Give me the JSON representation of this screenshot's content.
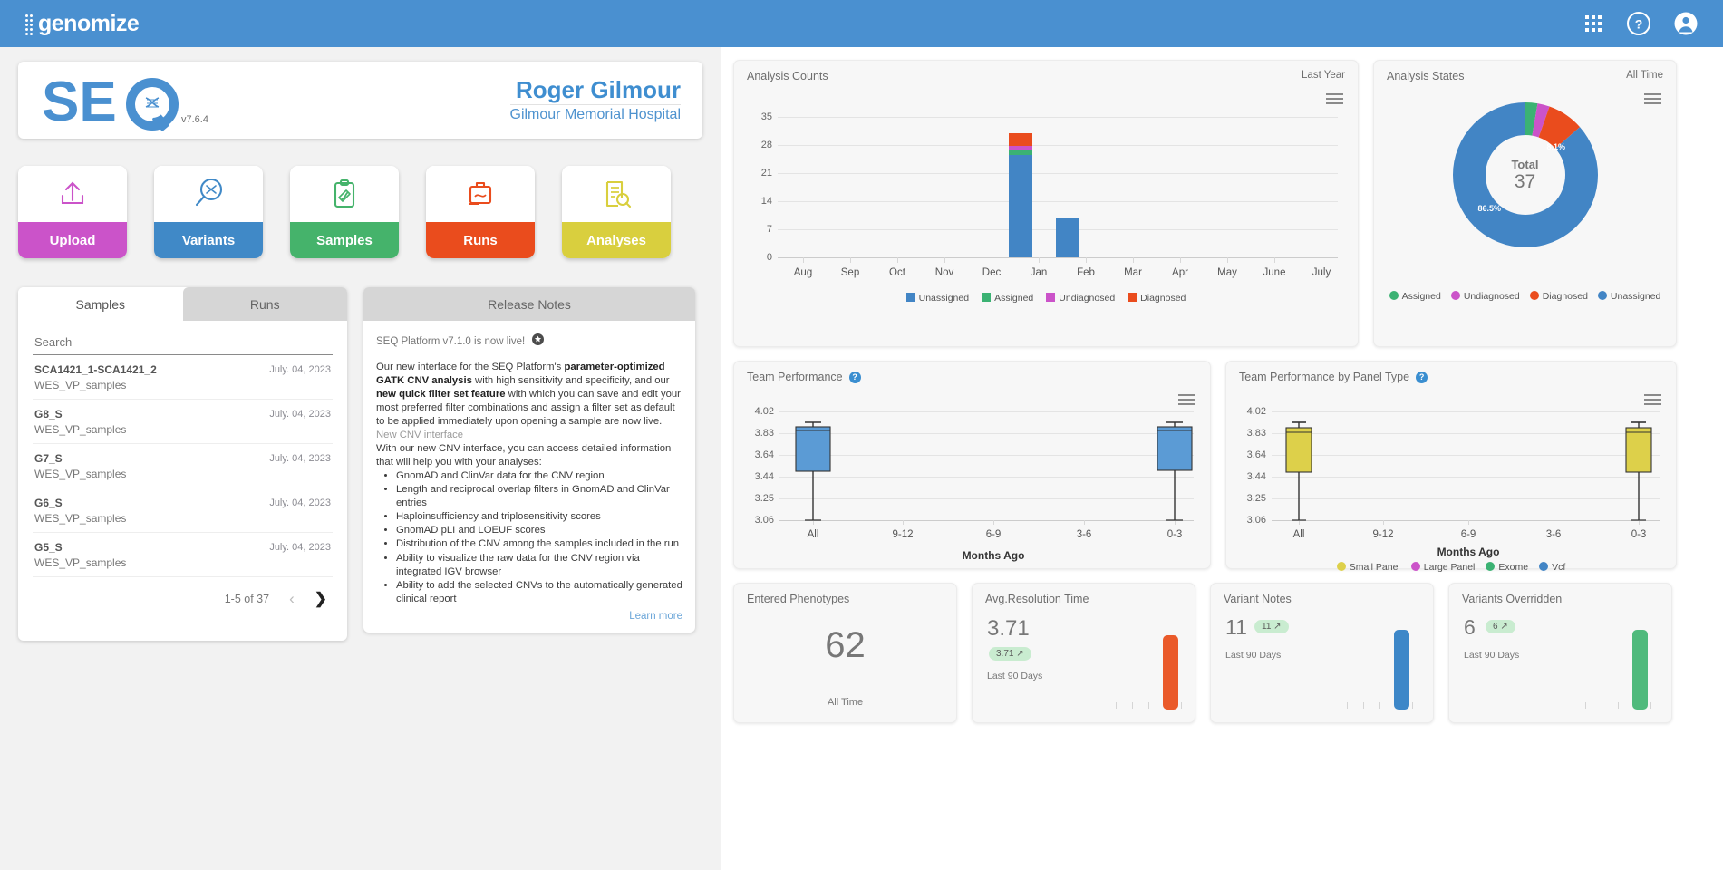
{
  "topbar": {
    "brand": "genomize",
    "icons": [
      "apps-grid-icon",
      "help-icon",
      "account-icon"
    ]
  },
  "profile": {
    "logo_text": "SEQ",
    "version": "v7.6.4",
    "user_name": "Roger Gilmour",
    "organization": "Gilmour Memorial Hospital"
  },
  "tiles": [
    {
      "label": "Upload",
      "color": "#cb53c9",
      "icon": "upload-icon"
    },
    {
      "label": "Variants",
      "color": "#4089c7",
      "icon": "variants-search-icon"
    },
    {
      "label": "Samples",
      "color": "#45b36b",
      "icon": "samples-clipboard-icon"
    },
    {
      "label": "Runs",
      "color": "#ea4c1d",
      "icon": "runs-briefcase-icon"
    },
    {
      "label": "Analyses",
      "color": "#d9cf3e",
      "icon": "analyses-report-icon"
    }
  ],
  "samples_panel": {
    "tabs": [
      {
        "label": "Samples",
        "active": true
      },
      {
        "label": "Runs",
        "active": false
      }
    ],
    "search_placeholder": "Search",
    "search_value": "",
    "rows": [
      {
        "title": "SCA1421_1-SCA1421_2",
        "subtitle": "WES_VP_samples",
        "date": "July. 04, 2023"
      },
      {
        "title": "G8_S",
        "subtitle": "WES_VP_samples",
        "date": "July. 04, 2023"
      },
      {
        "title": "G7_S",
        "subtitle": "WES_VP_samples",
        "date": "July. 04, 2023"
      },
      {
        "title": "G6_S",
        "subtitle": "WES_VP_samples",
        "date": "July. 04, 2023"
      },
      {
        "title": "G5_S",
        "subtitle": "WES_VP_samples",
        "date": "July. 04, 2023"
      }
    ],
    "pagination": {
      "range": "1-5 of 37",
      "prev": "‹",
      "next": "❯"
    }
  },
  "release_notes": {
    "tab_label": "Release Notes",
    "headline": "SEQ Platform v7.1.0 is now live!",
    "headline_icon": "star-badge-icon",
    "paragraph_1": {
      "a": "Our new interface for the SEQ Platform's ",
      "b1": "parameter-optimized GATK CNV analysis",
      "c": " with high sensitivity and specificity, and our ",
      "b2": "new quick filter set feature",
      "d": " with which you can save and edit your most preferred filter combinations and assign a filter set as default to be applied immediately upon opening a sample are now live."
    },
    "subhead": "New CNV interface",
    "paragraph_2": "With our new CNV interface, you can access detailed information that will help you with your analyses:",
    "bullets": [
      "GnomAD and ClinVar data for the CNV region",
      "Length and reciprocal overlap filters in GnomAD and ClinVar entries",
      "Haploinsufficiency and triplosensitivity scores",
      "GnomAD pLI and LOEUF scores",
      "Distribution of the CNV among the samples included in the run",
      "Ability to visualize the raw data for the CNV region via integrated IGV browser",
      "Ability to add the selected CNVs to the automatically generated clinical report"
    ],
    "learn_more": "Learn more"
  },
  "chart_data": [
    {
      "id": "analysis_counts",
      "type": "bar",
      "title": "Analysis Counts",
      "range_label": "Last Year",
      "stacked": true,
      "categories": [
        "Aug",
        "Sep",
        "Oct",
        "Nov",
        "Dec",
        "Jan",
        "Feb",
        "Mar",
        "Apr",
        "May",
        "June",
        "July"
      ],
      "series": [
        {
          "name": "Unassigned",
          "color": "#4285c5",
          "values": [
            0,
            0,
            0,
            0,
            0,
            23,
            9,
            0,
            0,
            0,
            0,
            0
          ]
        },
        {
          "name": "Assigned",
          "color": "#3bb273",
          "values": [
            0,
            0,
            0,
            0,
            0,
            1,
            0,
            0,
            0,
            0,
            0,
            0
          ]
        },
        {
          "name": "Undiagnosed",
          "color": "#cb53c9",
          "values": [
            0,
            0,
            0,
            0,
            0,
            1,
            0,
            0,
            0,
            0,
            0,
            0
          ]
        },
        {
          "name": "Diagnosed",
          "color": "#ea4c1d",
          "values": [
            0,
            0,
            0,
            0,
            0,
            3,
            0,
            0,
            0,
            0,
            0,
            0
          ]
        }
      ],
      "yticks": [
        "35",
        "28",
        "21",
        "14",
        "7",
        "0"
      ],
      "ylim": [
        0,
        35
      ],
      "xlabel": "",
      "ylabel": "",
      "grid": true,
      "legend_position": "bottom"
    },
    {
      "id": "analysis_states",
      "type": "pie",
      "title": "Analysis States",
      "range_label": "All Time",
      "center_label": "Total",
      "center_value": "37",
      "slices": [
        {
          "name": "Assigned",
          "color": "#3bb273",
          "percent": 2.7,
          "label": ""
        },
        {
          "name": "Undiagnosed",
          "color": "#cb53c9",
          "percent": 2.7,
          "label": ""
        },
        {
          "name": "Diagnosed",
          "color": "#ea4c1d",
          "percent": 8.1,
          "label": "8.1%"
        },
        {
          "name": "Unassigned",
          "color": "#4285c5",
          "percent": 86.5,
          "label": "86.5%"
        }
      ],
      "legend_position": "bottom"
    },
    {
      "id": "team_performance",
      "type": "box",
      "title": "Team Performance",
      "help_icon": "help-icon",
      "categories": [
        "All",
        "9-12",
        "6-9",
        "3-6",
        "0-3"
      ],
      "xlabel": "Months Ago",
      "yticks": [
        "4.02",
        "3.83",
        "3.64",
        "3.44",
        "3.25",
        "3.06"
      ],
      "ylim": [
        3.06,
        4.02
      ],
      "boxes": [
        {
          "category": "All",
          "color": "#5b9bd5",
          "low": 3.06,
          "q1": 3.66,
          "median": 3.9,
          "q3": 3.91,
          "high": 3.96
        },
        {
          "category": "9-12",
          "color": "#5b9bd5",
          "low": null,
          "q1": null,
          "median": null,
          "q3": null,
          "high": null
        },
        {
          "category": "6-9",
          "color": "#5b9bd5",
          "low": null,
          "q1": null,
          "median": null,
          "q3": null,
          "high": null
        },
        {
          "category": "3-6",
          "color": "#5b9bd5",
          "low": null,
          "q1": null,
          "median": null,
          "q3": null,
          "high": null
        },
        {
          "category": "0-3",
          "color": "#5b9bd5",
          "low": 3.06,
          "q1": 3.67,
          "median": 3.9,
          "q3": 3.92,
          "high": 3.96
        }
      ],
      "legend": []
    },
    {
      "id": "team_performance_panel",
      "type": "box",
      "title": "Team Performance by Panel Type",
      "help_icon": "help-icon",
      "categories": [
        "All",
        "9-12",
        "6-9",
        "3-6",
        "0-3"
      ],
      "xlabel": "Months Ago",
      "yticks": [
        "4.02",
        "3.83",
        "3.64",
        "3.44",
        "3.25",
        "3.06"
      ],
      "ylim": [
        3.06,
        4.02
      ],
      "boxes": [
        {
          "category": "All",
          "color": "#ddd04a",
          "low": 3.06,
          "q1": 3.67,
          "median": 3.89,
          "q3": 3.92,
          "high": 3.96
        },
        {
          "category": "0-3",
          "color": "#ddd04a",
          "low": 3.06,
          "q1": 3.67,
          "median": 3.89,
          "q3": 3.92,
          "high": 3.96
        }
      ],
      "legend": [
        {
          "name": "Small Panel",
          "color": "#ddd04a"
        },
        {
          "name": "Large Panel",
          "color": "#cb53c9"
        },
        {
          "name": "Exome",
          "color": "#3bb273"
        },
        {
          "name": "Vcf",
          "color": "#4285c5"
        }
      ]
    }
  ],
  "stat_cards": [
    {
      "title": "Entered Phenotypes",
      "value": "62",
      "chip": "",
      "period": "All Time",
      "spark_color": "",
      "layout": "centered"
    },
    {
      "title": "Avg.Resolution Time",
      "value": "3.71",
      "chip": "3.71 ↗",
      "period": "Last 90 Days",
      "spark_color": "#ea5a2a",
      "layout": "spark"
    },
    {
      "title": "Variant Notes",
      "value": "11",
      "chip": "11 ↗",
      "period": "Last 90 Days",
      "spark_color": "#3d87c8",
      "layout": "spark-inline"
    },
    {
      "title": "Variants Overridden",
      "value": "6",
      "chip": "6 ↗",
      "period": "Last 90 Days",
      "spark_color": "#4fba7c",
      "layout": "spark-inline"
    }
  ]
}
